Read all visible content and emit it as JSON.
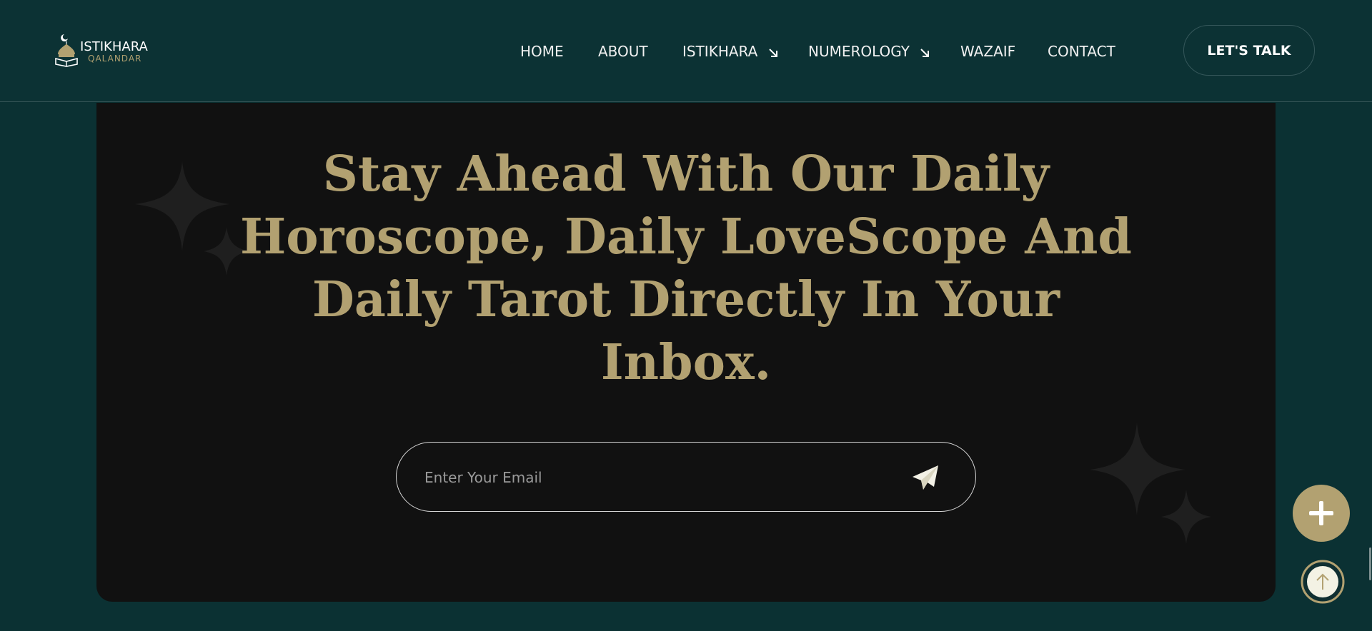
{
  "header": {
    "logo": {
      "line1": "ISTIKHARA",
      "line2": "QALANDAR"
    },
    "nav": [
      {
        "label": "HOME",
        "has_arrow": false
      },
      {
        "label": "ABOUT",
        "has_arrow": false
      },
      {
        "label": "ISTIKHARA",
        "has_arrow": true
      },
      {
        "label": "NUMEROLOGY",
        "has_arrow": true
      },
      {
        "label": "WAZAIF",
        "has_arrow": false
      },
      {
        "label": "CONTACT",
        "has_arrow": false
      }
    ],
    "cta_label": "LET'S TALK"
  },
  "newsletter": {
    "headline": "Stay Ahead With Our Daily Horoscope, Daily LoveScope And Daily Tarot Directly In Your Inbox.",
    "email_placeholder": "Enter Your Email",
    "email_value": "",
    "send_icon": "paper-plane-icon"
  },
  "floating": {
    "plus_icon": "plus-icon",
    "scroll_top_icon": "arrow-up-icon"
  },
  "colors": {
    "page_bg": "#0b3133",
    "card_bg": "#111111",
    "accent_gold": "#b2a171",
    "nav_text": "#f1f1f1"
  }
}
